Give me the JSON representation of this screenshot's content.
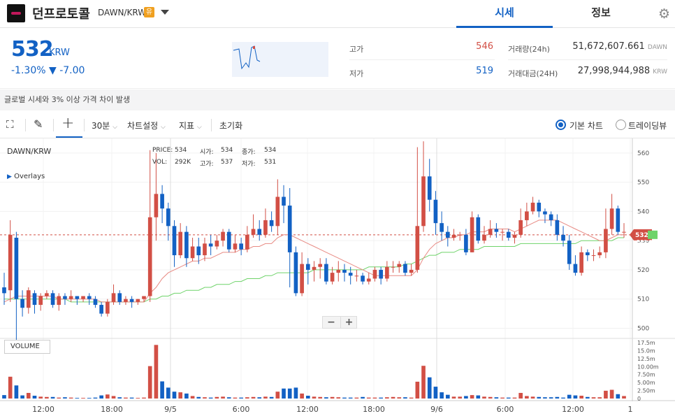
{
  "header": {
    "coin_name": "던프로토콜",
    "pair": "DAWN/KRW",
    "warning_badge": "유",
    "tabs": [
      {
        "label": "시세",
        "active": true
      },
      {
        "label": "정보",
        "active": false
      }
    ]
  },
  "price": {
    "current": "532",
    "unit": "KRW",
    "change": "-1.30% ▼ -7.00",
    "high_label": "고가",
    "high_value": "546",
    "low_label": "저가",
    "low_value": "519",
    "volume_label": "거래량(24h)",
    "volume_value": "51,672,607.661",
    "volume_unit": "DAWN",
    "amount_label": "거래대금(24H)",
    "amount_value": "27,998,944,988",
    "amount_unit": "KRW"
  },
  "notice": "글로벌 시세와 3% 이상 가격 차이 발생",
  "toolbar": {
    "interval": "30분",
    "chart_settings": "차트설정",
    "indicators": "지표",
    "reset": "초기화",
    "radio_basic": "기본 차트",
    "radio_tradingview": "트레이딩뷰"
  },
  "chart_overlay": {
    "pair": "DAWN/KRW",
    "overlays": "Overlays",
    "price_label": "PRICE:",
    "price_value": "534",
    "open_label": "시가:",
    "open_value": "534",
    "close_label": "종가:",
    "close_value": "534",
    "vol_label": "VOL:",
    "vol_value": "292K",
    "high_label": "고가:",
    "high_value": "537",
    "low_label": "저가:",
    "low_value": "531",
    "volume_panel": "VOLUME",
    "last_price_tag": "532",
    "last_price_tag2": "533.2"
  },
  "colors": {
    "up": "#d24f45",
    "down": "#1261c4",
    "ma_short": "#e88a83",
    "ma_long": "#6fd36a"
  },
  "chart_data": {
    "type": "candlestick",
    "y_ticks": [
      500,
      510,
      520,
      530,
      540,
      550,
      560
    ],
    "ylim": [
      497,
      565
    ],
    "x_labels": [
      "12:00",
      "18:00",
      "9/5",
      "6:00",
      "12:00",
      "18:00",
      "9/6",
      "6:00",
      "12:00",
      "1"
    ],
    "vol_ticks": [
      "17.5m",
      "15.0m",
      "12.5m",
      "10.00m",
      "7.50m",
      "5.00m",
      "2.50m",
      "0"
    ],
    "vol_max": 17.5,
    "last_price": 532,
    "candles": [
      [
        514,
        512,
        519,
        508,
        1.1
      ],
      [
        513,
        532,
        537,
        509,
        7.0
      ],
      [
        531,
        510,
        533,
        495,
        4.2
      ],
      [
        510,
        507,
        513,
        504,
        1.0
      ],
      [
        507,
        513,
        514,
        505,
        1.8
      ],
      [
        512,
        508,
        513,
        505,
        0.9
      ],
      [
        508,
        511,
        512,
        506,
        0.6
      ],
      [
        511,
        512,
        513,
        510,
        0.5
      ],
      [
        512,
        508,
        513,
        507,
        0.5
      ],
      [
        508,
        511,
        512,
        506,
        0.3
      ],
      [
        511,
        510,
        512,
        508,
        0.4
      ],
      [
        510,
        511,
        513,
        509,
        0.3
      ],
      [
        511,
        510,
        511,
        508,
        0.2
      ],
      [
        510,
        511,
        511,
        509,
        0.2
      ],
      [
        511,
        510,
        512,
        508,
        0.2
      ],
      [
        510,
        508,
        511,
        507,
        0.3
      ],
      [
        508,
        505,
        509,
        504,
        1.0
      ],
      [
        505,
        509,
        510,
        504,
        1.3
      ],
      [
        509,
        512,
        515,
        508,
        0.8
      ],
      [
        512,
        509,
        513,
        508,
        0.4
      ],
      [
        509,
        510,
        511,
        508,
        0.3
      ],
      [
        510,
        509,
        511,
        507,
        0.3
      ],
      [
        509,
        510,
        510,
        508,
        0.2
      ],
      [
        510,
        511,
        511,
        509,
        0.3
      ],
      [
        511,
        538,
        561,
        509,
        10.4
      ],
      [
        538,
        546,
        560,
        530,
        17.2
      ],
      [
        546,
        541,
        549,
        536,
        5.5
      ],
      [
        541,
        535,
        543,
        530,
        3.5
      ],
      [
        535,
        525,
        537,
        521,
        2.2
      ],
      [
        525,
        533,
        536,
        524,
        2.0
      ],
      [
        533,
        524,
        535,
        521,
        1.6
      ],
      [
        524,
        528,
        531,
        523,
        0.8
      ],
      [
        528,
        525,
        531,
        522,
        0.5
      ],
      [
        525,
        529,
        531,
        523,
        0.4
      ],
      [
        529,
        528,
        532,
        525,
        0.3
      ],
      [
        528,
        530,
        532,
        527,
        0.5
      ],
      [
        530,
        533,
        534,
        528,
        0.6
      ],
      [
        533,
        527,
        534,
        526,
        0.4
      ],
      [
        527,
        529,
        532,
        526,
        0.3
      ],
      [
        529,
        527,
        531,
        525,
        0.3
      ],
      [
        527,
        532,
        535,
        526,
        0.4
      ],
      [
        532,
        534,
        539,
        531,
        0.5
      ],
      [
        534,
        532,
        537,
        530,
        0.4
      ],
      [
        532,
        537,
        541,
        531,
        0.6
      ],
      [
        537,
        535,
        540,
        533,
        0.5
      ],
      [
        535,
        545,
        551,
        532,
        2.2
      ],
      [
        545,
        542,
        549,
        536,
        3.2
      ],
      [
        542,
        526,
        548,
        514,
        3.2
      ],
      [
        526,
        512,
        528,
        511,
        3.5
      ],
      [
        512,
        522,
        526,
        511,
        1.6
      ],
      [
        522,
        520,
        524,
        515,
        0.9
      ],
      [
        520,
        521,
        523,
        516,
        0.6
      ],
      [
        521,
        522,
        524,
        517,
        0.5
      ],
      [
        522,
        516,
        524,
        515,
        0.4
      ],
      [
        516,
        519,
        521,
        515,
        0.5
      ],
      [
        519,
        520,
        523,
        516,
        0.4
      ],
      [
        520,
        519,
        522,
        516,
        0.3
      ],
      [
        519,
        518,
        521,
        515,
        0.3
      ],
      [
        518,
        518,
        520,
        516,
        0.3
      ],
      [
        518,
        516,
        519,
        515,
        0.5
      ],
      [
        516,
        517,
        519,
        515,
        0.3
      ],
      [
        517,
        520,
        521,
        516,
        0.3
      ],
      [
        520,
        517,
        521,
        515,
        0.3
      ],
      [
        517,
        521,
        523,
        516,
        0.4
      ],
      [
        521,
        521,
        523,
        519,
        0.5
      ],
      [
        521,
        522,
        523,
        519,
        0.4
      ],
      [
        522,
        519,
        523,
        518,
        0.4
      ],
      [
        519,
        520,
        522,
        518,
        0.3
      ],
      [
        520,
        535,
        562,
        519,
        5.4
      ],
      [
        535,
        552,
        564,
        533,
        10.5
      ],
      [
        552,
        544,
        558,
        540,
        6.8
      ],
      [
        544,
        536,
        547,
        532,
        3.8
      ],
      [
        536,
        533,
        540,
        530,
        2.0
      ],
      [
        533,
        531,
        535,
        528,
        1.2
      ],
      [
        531,
        532,
        534,
        530,
        0.6
      ],
      [
        532,
        532,
        533,
        530,
        0.6
      ],
      [
        532,
        526,
        534,
        525,
        0.8
      ],
      [
        526,
        538,
        540,
        526,
        1.1
      ],
      [
        538,
        530,
        539,
        529,
        1.0
      ],
      [
        530,
        532,
        535,
        529,
        0.6
      ],
      [
        532,
        534,
        537,
        531,
        0.5
      ],
      [
        534,
        533,
        536,
        531,
        0.4
      ],
      [
        533,
        533,
        534,
        530,
        0.3
      ],
      [
        533,
        531,
        534,
        530,
        0.3
      ],
      [
        531,
        532,
        533,
        529,
        0.3
      ],
      [
        532,
        537,
        541,
        531,
        1.8
      ],
      [
        537,
        540,
        543,
        535,
        0.8
      ],
      [
        540,
        543,
        545,
        539,
        0.6
      ],
      [
        543,
        540,
        544,
        538,
        0.5
      ],
      [
        540,
        539,
        541,
        536,
        0.4
      ],
      [
        539,
        537,
        540,
        535,
        0.4
      ],
      [
        537,
        532,
        539,
        530,
        0.5
      ],
      [
        532,
        530,
        535,
        528,
        0.3
      ],
      [
        530,
        522,
        532,
        520,
        1.2
      ],
      [
        522,
        519,
        525,
        518,
        1.0
      ],
      [
        519,
        526,
        528,
        518,
        0.9
      ],
      [
        526,
        525,
        527,
        523,
        0.5
      ],
      [
        525,
        525,
        527,
        523,
        0.4
      ],
      [
        525,
        526,
        528,
        524,
        0.4
      ],
      [
        526,
        534,
        541,
        524,
        2.5
      ],
      [
        534,
        541,
        546,
        532,
        2.8
      ],
      [
        541,
        533,
        542,
        532,
        1.4
      ],
      [
        533,
        533,
        536,
        531,
        0.8
      ]
    ],
    "ma_short": [
      509,
      510,
      511,
      511,
      511,
      511,
      511,
      511,
      511,
      510,
      510,
      510,
      510,
      510,
      510,
      510,
      509,
      509,
      509,
      509,
      509,
      509,
      509,
      509,
      512,
      514,
      517,
      519,
      520,
      521,
      522,
      523,
      523,
      524,
      524,
      525,
      526,
      526,
      526,
      527,
      527,
      528,
      528,
      529,
      529,
      531,
      532,
      532,
      531,
      530,
      529,
      528,
      527,
      526,
      525,
      524,
      523,
      522,
      521,
      520,
      519,
      518,
      518,
      518,
      518,
      518,
      518,
      518,
      520,
      524,
      527,
      529,
      530,
      531,
      531,
      532,
      532,
      533,
      533,
      533,
      534,
      534,
      534,
      534,
      533,
      534,
      535,
      536,
      537,
      537,
      537,
      537,
      536,
      535,
      534,
      533,
      532,
      531,
      530,
      530,
      531,
      532,
      532
    ],
    "ma_long": [
      510,
      510,
      510,
      510,
      510,
      510,
      510,
      510,
      510,
      510,
      510,
      509,
      509,
      509,
      509,
      509,
      509,
      509,
      509,
      509,
      509,
      509,
      509,
      509,
      510,
      510,
      511,
      511,
      512,
      512,
      513,
      513,
      513,
      514,
      514,
      515,
      515,
      515,
      516,
      516,
      517,
      517,
      517,
      518,
      518,
      519,
      519,
      519,
      519,
      519,
      519,
      520,
      520,
      520,
      520,
      520,
      520,
      520,
      520,
      520,
      521,
      521,
      521,
      521,
      521,
      521,
      522,
      522,
      523,
      524,
      525,
      525,
      526,
      526,
      526,
      527,
      527,
      527,
      527,
      528,
      528,
      528,
      528,
      528,
      528,
      529,
      529,
      529,
      529,
      529,
      529,
      529,
      529,
      529,
      529,
      530,
      530,
      530,
      530,
      530,
      530,
      531,
      531
    ]
  }
}
